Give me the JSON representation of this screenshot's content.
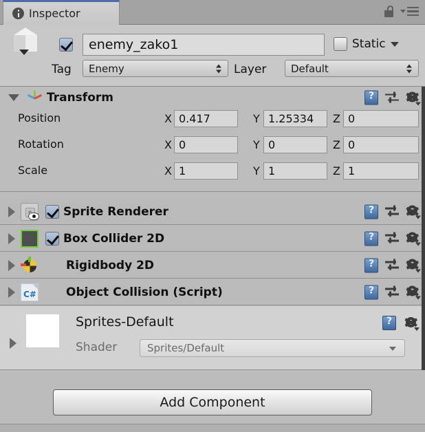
{
  "window": {
    "tab_label": "Inspector",
    "tab_icon": "info-icon",
    "lock_icon": "unlocked-padlock-icon",
    "menu_icon": "hamburger-menu-icon"
  },
  "gameobject": {
    "icon": "cube-icon",
    "enabled": true,
    "name": "enemy_zako1",
    "static_label": "Static",
    "static_checked": false,
    "tag_label": "Tag",
    "tag_value": "Enemy",
    "layer_label": "Layer",
    "layer_value": "Default"
  },
  "transform": {
    "title": "Transform",
    "icon": "transform-axis-icon",
    "expanded": true,
    "rows": [
      {
        "label": "Position",
        "x": "0.417",
        "y": "1.25334",
        "z": "0"
      },
      {
        "label": "Rotation",
        "x": "0",
        "y": "0",
        "z": "0"
      },
      {
        "label": "Scale",
        "x": "1",
        "y": "1",
        "z": "1"
      }
    ],
    "axis_labels": {
      "x": "X",
      "y": "Y",
      "z": "Z"
    }
  },
  "components": [
    {
      "name": "Sprite Renderer",
      "icon": "sprite-renderer-icon",
      "has_checkbox": true,
      "checked": true
    },
    {
      "name": "Box Collider 2D",
      "icon": "box-collider-2d-icon",
      "has_checkbox": true,
      "checked": true
    },
    {
      "name": "Rigidbody 2D",
      "icon": "rigidbody-2d-icon",
      "has_checkbox": false,
      "checked": false
    },
    {
      "name": "Object Collision (Script)",
      "icon": "csharp-script-icon",
      "has_checkbox": false,
      "checked": false
    }
  ],
  "material": {
    "name": "Sprites-Default",
    "shader_label": "Shader",
    "shader_value": "Sprites/Default"
  },
  "footer": {
    "add_component_label": "Add Component"
  },
  "icons": {
    "help": "help-book-icon",
    "preset": "preset-sliders-icon",
    "gear": "gear-icon"
  },
  "colors": {
    "tab_accent": "#4b6ea8",
    "panel_bg": "#bcbcbc",
    "collider_green": "#6fd13a",
    "checkbox_blue": "#8fa6c6"
  }
}
